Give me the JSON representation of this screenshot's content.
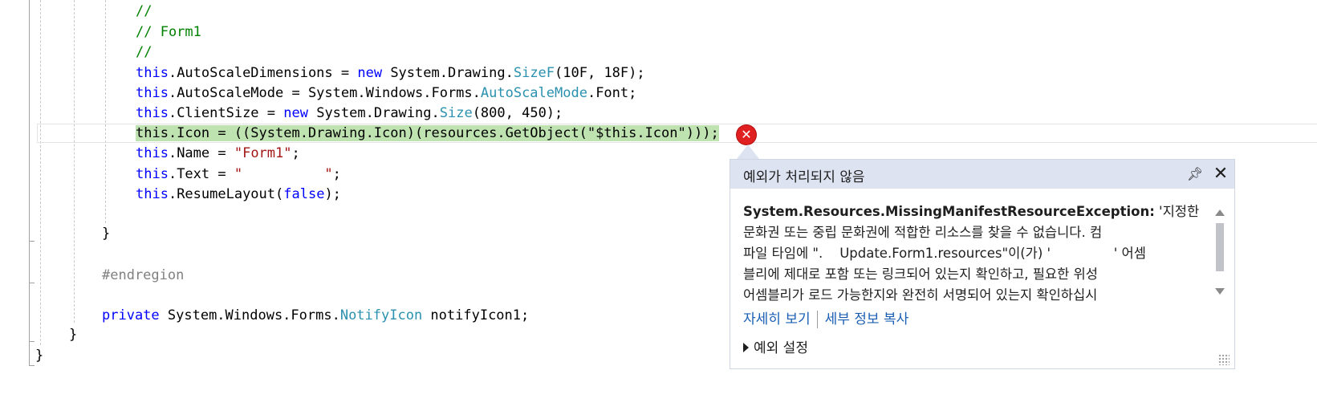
{
  "code": {
    "comment1": "//",
    "comment2": "// Form1",
    "comment3": "//",
    "l_autoscale_dim": {
      "this": "this",
      "a": ".AutoScaleDimensions = ",
      "new": "new",
      "b": " System.Drawing.",
      "type": "SizeF",
      "c": "(10F, 18F);"
    },
    "l_autoscale_mode": {
      "this": "this",
      "a": ".AutoScaleMode = System.Windows.Forms.",
      "type": "AutoScaleMode",
      "c": ".Font;"
    },
    "l_client_size": {
      "this": "this",
      "a": ".ClientSize = ",
      "new": "new",
      "b": " System.Drawing.",
      "type": "Size",
      "c": "(800, 450);"
    },
    "l_icon": "this.Icon = ((System.Drawing.Icon)(resources.GetObject(\"$this.Icon\")));",
    "l_name": {
      "this": "this",
      "a": ".Name = ",
      "str": "\"Form1\"",
      "c": ";"
    },
    "l_text": {
      "this": "this",
      "a": ".Text = ",
      "str": "\"          \"",
      "c": ";"
    },
    "l_resume": {
      "this": "this",
      "a": ".ResumeLayout(",
      "kw": "false",
      "c": ");"
    },
    "close_brace_method": "}",
    "endregion": "#endregion",
    "l_field": {
      "kw": "private",
      "a": " System.Windows.Forms.",
      "type": "NotifyIcon",
      "c": " notifyIcon1;"
    },
    "close_brace_class": "}",
    "close_brace_ns": "}"
  },
  "exception_popup": {
    "title": "예외가 처리되지 않음",
    "exception_type": "System.Resources.MissingManifestResourceException:",
    "message_lines": [
      " '지정한",
      "문화권 또는 중립 문화권에 적합한 리소스를 찾을 수 없습니다. 컴",
      "파일 타임에 \".    Update.Form1.resources\"이(가) '               ' 어셈",
      "블리에 제대로 포함 또는 링크되어 있는지 확인하고, 필요한 위성",
      "어셈블리가 로드 가능한지와 완전히 서명되어 있는지 확인하십시"
    ],
    "view_details": "자세히 보기",
    "copy_details": "세부 정보 복사",
    "exception_settings": "예외 설정"
  },
  "colors": {
    "keyword": "#0000ff",
    "type": "#2b91af",
    "string": "#a31515",
    "comment": "#008000",
    "highlight": "#bfe3b0",
    "error": "#e02020"
  }
}
